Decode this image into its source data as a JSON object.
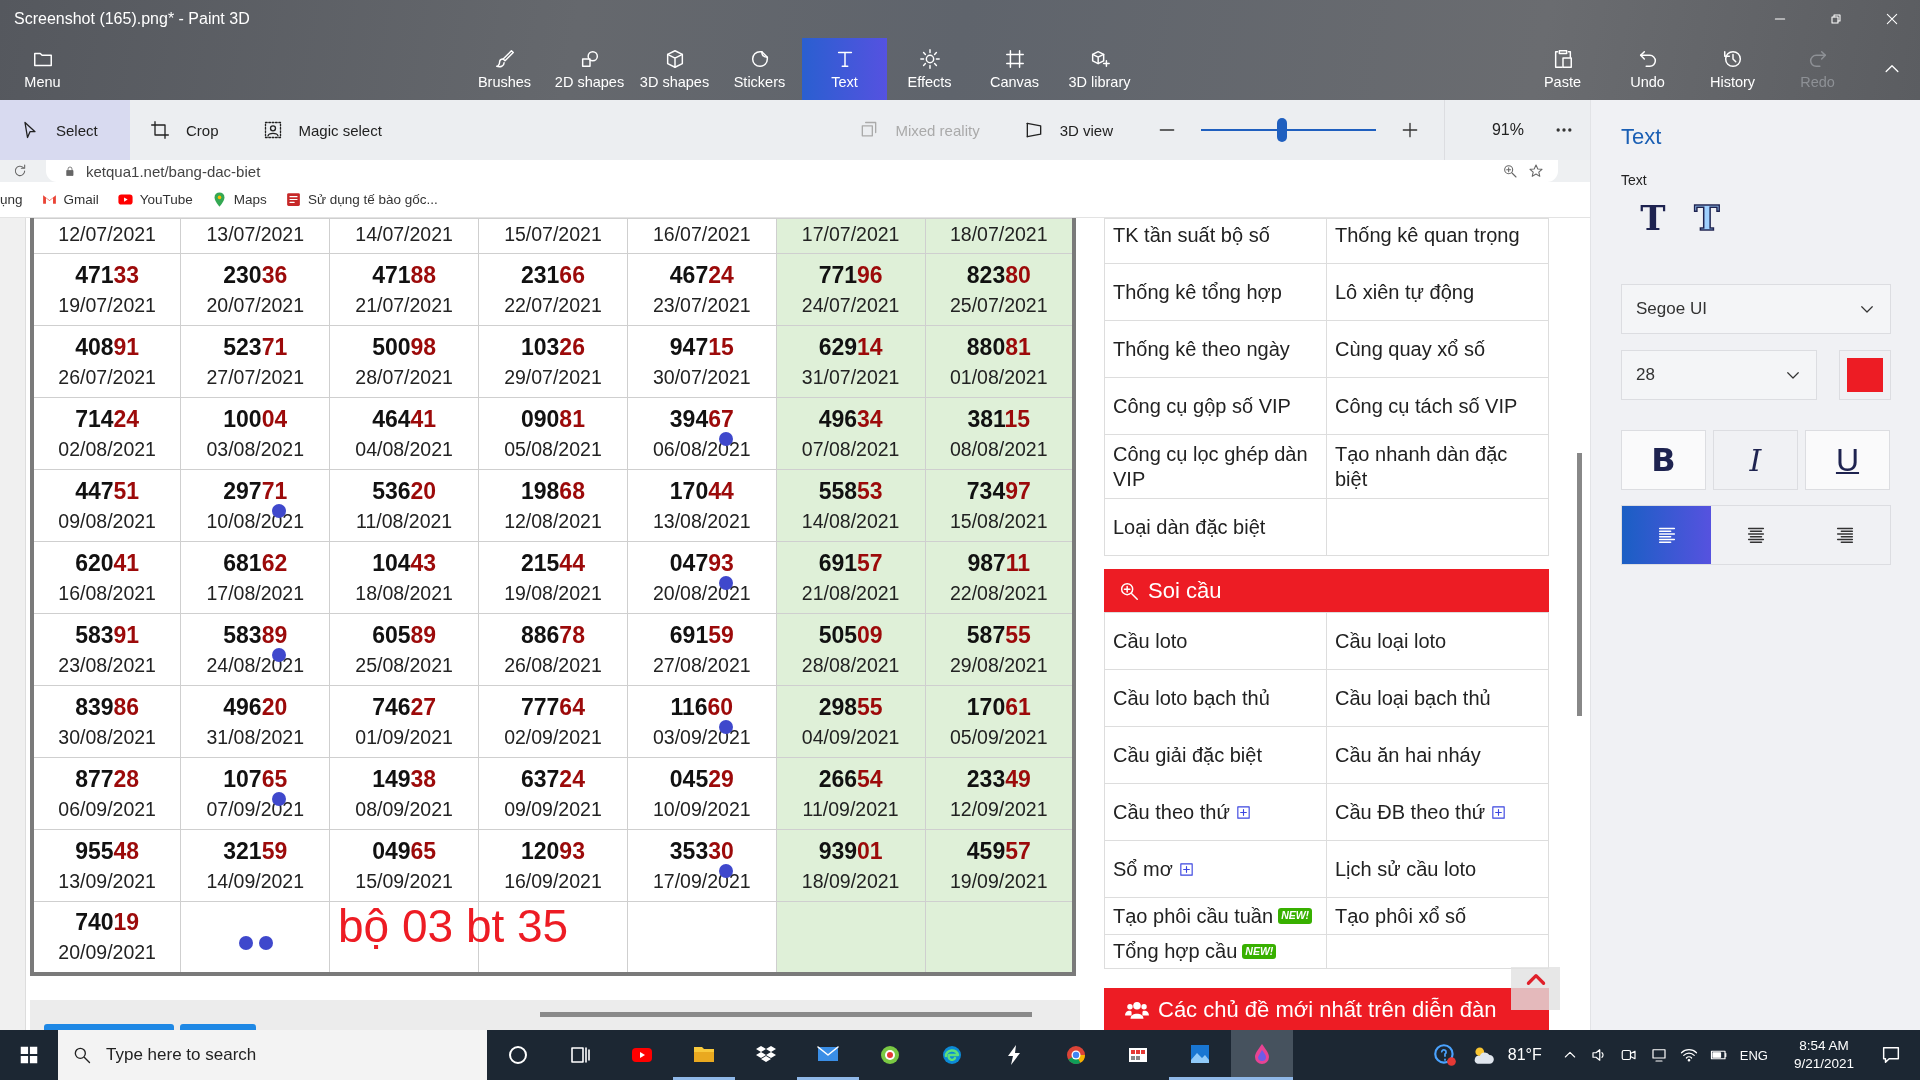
{
  "window": {
    "title": "Screenshot (165).png* - Paint 3D"
  },
  "menu_button": {
    "label": "Menu"
  },
  "tools": [
    {
      "label": "Brushes",
      "kind": "brush",
      "selected": false
    },
    {
      "label": "2D shapes",
      "kind": "shapes",
      "selected": false
    },
    {
      "label": "3D shapes",
      "kind": "cube",
      "selected": false
    },
    {
      "label": "Stickers",
      "kind": "sticker",
      "selected": false
    },
    {
      "label": "Text",
      "kind": "text",
      "selected": true
    },
    {
      "label": "Effects",
      "kind": "effects",
      "selected": false
    },
    {
      "label": "Canvas",
      "kind": "canvas",
      "selected": false
    },
    {
      "label": "3D library",
      "kind": "library",
      "selected": false
    }
  ],
  "actions": [
    {
      "label": "Paste",
      "kind": "paste",
      "disabled": false
    },
    {
      "label": "Undo",
      "kind": "undo",
      "disabled": false
    },
    {
      "label": "History",
      "kind": "history",
      "disabled": false
    },
    {
      "label": "Redo",
      "kind": "redo",
      "disabled": true
    }
  ],
  "subtools": [
    {
      "label": "Select",
      "kind": "select",
      "selected": true
    },
    {
      "label": "Crop",
      "kind": "crop",
      "selected": false
    },
    {
      "label": "Magic select",
      "kind": "magic",
      "selected": false
    }
  ],
  "view_controls": [
    {
      "label": "Mixed reality",
      "kind": "mixed",
      "disabled": true
    },
    {
      "label": "3D view",
      "kind": "view3d",
      "disabled": false
    }
  ],
  "zoom": {
    "level": 0.46,
    "reading": "91%"
  },
  "browser": {
    "url": "ketqua1.net/bang-dac-biet",
    "bookmarks": [
      {
        "label": "ụng",
        "kind": "none"
      },
      {
        "label": "Gmail",
        "kind": "gmail"
      },
      {
        "label": "YouTube",
        "kind": "youtube"
      },
      {
        "label": "Maps",
        "kind": "maps"
      },
      {
        "label": "Sử dụng tế bào gốc...",
        "kind": "doc"
      }
    ]
  },
  "table": {
    "columns": [
      {
        "highlighted": false
      },
      {
        "highlighted": false
      },
      {
        "highlighted": false
      },
      {
        "highlighted": false
      },
      {
        "highlighted": false
      },
      {
        "highlighted": true
      },
      {
        "highlighted": true
      }
    ],
    "header_dates": [
      "12/07/2021",
      "13/07/2021",
      "14/07/2021",
      "15/07/2021",
      "16/07/2021",
      "17/07/2021",
      "18/07/2021"
    ],
    "rows": [
      {
        "cells": [
          {
            "number": "47133",
            "date": "19/07/2021"
          },
          {
            "number": "23036",
            "date": "20/07/2021"
          },
          {
            "number": "47188",
            "date": "21/07/2021"
          },
          {
            "number": "23166",
            "date": "22/07/2021"
          },
          {
            "number": "46724",
            "date": "23/07/2021"
          },
          {
            "number": "77196",
            "date": "24/07/2021"
          },
          {
            "number": "82380",
            "date": "25/07/2021"
          }
        ]
      },
      {
        "cells": [
          {
            "number": "40891",
            "date": "26/07/2021"
          },
          {
            "number": "52371",
            "date": "27/07/2021"
          },
          {
            "number": "50098",
            "date": "28/07/2021"
          },
          {
            "number": "10326",
            "date": "29/07/2021"
          },
          {
            "number": "94715",
            "date": "30/07/2021"
          },
          {
            "number": "62914",
            "date": "31/07/2021"
          },
          {
            "number": "88081",
            "date": "01/08/2021"
          }
        ]
      },
      {
        "cells": [
          {
            "number": "71424",
            "date": "02/08/2021"
          },
          {
            "number": "10004",
            "date": "03/08/2021"
          },
          {
            "number": "46441",
            "date": "04/08/2021"
          },
          {
            "number": "09081",
            "date": "05/08/2021"
          },
          {
            "number": "39467",
            "date": "06/08/2021",
            "marked": true
          },
          {
            "number": "49634",
            "date": "07/08/2021"
          },
          {
            "number": "38115",
            "date": "08/08/2021"
          }
        ]
      },
      {
        "cells": [
          {
            "number": "44751",
            "date": "09/08/2021"
          },
          {
            "number": "29771",
            "date": "10/08/2021",
            "marked": true
          },
          {
            "number": "53620",
            "date": "11/08/2021"
          },
          {
            "number": "19868",
            "date": "12/08/2021"
          },
          {
            "number": "17044",
            "date": "13/08/2021"
          },
          {
            "number": "55853",
            "date": "14/08/2021"
          },
          {
            "number": "73497",
            "date": "15/08/2021"
          }
        ]
      },
      {
        "cells": [
          {
            "number": "62041",
            "date": "16/08/2021"
          },
          {
            "number": "68162",
            "date": "17/08/2021"
          },
          {
            "number": "10443",
            "date": "18/08/2021"
          },
          {
            "number": "21544",
            "date": "19/08/2021"
          },
          {
            "number": "04793",
            "date": "20/08/2021",
            "marked": true
          },
          {
            "number": "69157",
            "date": "21/08/2021"
          },
          {
            "number": "98711",
            "date": "22/08/2021"
          }
        ]
      },
      {
        "cells": [
          {
            "number": "58391",
            "date": "23/08/2021"
          },
          {
            "number": "58389",
            "date": "24/08/2021",
            "marked": true
          },
          {
            "number": "60589",
            "date": "25/08/2021"
          },
          {
            "number": "88678",
            "date": "26/08/2021"
          },
          {
            "number": "69159",
            "date": "27/08/2021"
          },
          {
            "number": "50509",
            "date": "28/08/2021"
          },
          {
            "number": "58755",
            "date": "29/08/2021"
          }
        ]
      },
      {
        "cells": [
          {
            "number": "83986",
            "date": "30/08/2021"
          },
          {
            "number": "49620",
            "date": "31/08/2021"
          },
          {
            "number": "74627",
            "date": "01/09/2021"
          },
          {
            "number": "77764",
            "date": "02/09/2021"
          },
          {
            "number": "11660",
            "date": "03/09/2021",
            "marked": true
          },
          {
            "number": "29855",
            "date": "04/09/2021"
          },
          {
            "number": "17061",
            "date": "05/09/2021"
          }
        ]
      },
      {
        "cells": [
          {
            "number": "87728",
            "date": "06/09/2021"
          },
          {
            "number": "10765",
            "date": "07/09/2021",
            "marked": true
          },
          {
            "number": "14938",
            "date": "08/09/2021"
          },
          {
            "number": "63724",
            "date": "09/09/2021"
          },
          {
            "number": "04529",
            "date": "10/09/2021"
          },
          {
            "number": "26654",
            "date": "11/09/2021"
          },
          {
            "number": "23349",
            "date": "12/09/2021"
          }
        ]
      },
      {
        "cells": [
          {
            "number": "95548",
            "date": "13/09/2021"
          },
          {
            "number": "32159",
            "date": "14/09/2021"
          },
          {
            "number": "04965",
            "date": "15/09/2021"
          },
          {
            "number": "12093",
            "date": "16/09/2021"
          },
          {
            "number": "35330",
            "date": "17/09/2021",
            "marked": true
          },
          {
            "number": "93901",
            "date": "18/09/2021"
          },
          {
            "number": "45957",
            "date": "19/09/2021"
          }
        ]
      },
      {
        "cells": [
          {
            "number": "74019",
            "date": "20/09/2021"
          },
          {
            "marked": true,
            "double": true
          }
        ]
      }
    ]
  },
  "canvas_text": {
    "text": "bộ 03 bt 35",
    "color": "#ed1c24"
  },
  "link_table": {
    "rows": [
      [
        {
          "text": "TK tần suất bộ số"
        },
        {
          "text": "Thống kê quan trọng"
        }
      ],
      [
        {
          "text": "Thống kê tổng hợp"
        },
        {
          "text": "Lô xiên tự động"
        }
      ],
      [
        {
          "text": "Thống kê theo ngày"
        },
        {
          "text": "Cùng quay xổ số"
        }
      ],
      [
        {
          "text": "Công cụ gộp số VIP"
        },
        {
          "text": "Công cụ tách số VIP"
        }
      ],
      [
        {
          "text": "Công cụ lọc ghép dàn VIP"
        },
        {
          "text": "Tạo nhanh dàn đặc biệt"
        }
      ],
      [
        {
          "text": "Loại dàn đặc biệt"
        }
      ]
    ]
  },
  "soi_cau": {
    "title": "Soi cầu",
    "rows": [
      [
        {
          "text": "Cầu loto"
        },
        {
          "text": "Cầu loại loto"
        }
      ],
      [
        {
          "text": "Cầu loto bạch thủ"
        },
        {
          "text": "Cầu loại bạch thủ"
        }
      ],
      [
        {
          "text": "Cầu giải đặc biệt"
        },
        {
          "text": "Cầu ăn hai nháy"
        }
      ],
      [
        {
          "text": "Cầu theo thứ",
          "expandable": true
        },
        {
          "text": "Cầu ĐB theo thứ",
          "expandable": true
        }
      ],
      [
        {
          "text": "Sổ mơ",
          "expandable": true
        },
        {
          "text": "Lịch sử cầu loto"
        }
      ],
      [
        {
          "text": "Tạo phôi cầu tuần",
          "badge": "NEW!"
        },
        {
          "text": "Tạo phôi xổ số"
        }
      ],
      [
        {
          "text": "Tổng hợp cầu",
          "badge": "NEW!"
        }
      ]
    ]
  },
  "forum": {
    "title": "Các chủ đề mới nhất trên diễn đàn"
  },
  "side_panel": {
    "title": "Text",
    "section_label": "Text",
    "text_types": [
      {
        "glyph": "T",
        "kind": "flat"
      },
      {
        "glyph": "T",
        "kind": "solid"
      }
    ],
    "font": "Segoe UI",
    "size": "28",
    "color": "#ed1c24",
    "styles": [
      {
        "label": "B",
        "kind": "bold"
      },
      {
        "label": "I",
        "kind": "italic"
      },
      {
        "label": "U",
        "kind": "underline"
      }
    ],
    "alignments": [
      {
        "kind": "left",
        "selected": true
      },
      {
        "kind": "center",
        "selected": false
      },
      {
        "kind": "right",
        "selected": false
      }
    ]
  },
  "taskbar": {
    "search": {
      "placeholder": "Type here to search"
    },
    "apps": [
      {
        "kind": "cortana",
        "running": false,
        "active": false
      },
      {
        "kind": "taskview",
        "running": false,
        "active": false
      },
      {
        "kind": "youtube",
        "running": false,
        "active": false
      },
      {
        "kind": "explorer",
        "running": true,
        "active": false
      },
      {
        "kind": "dropbox",
        "running": false,
        "active": false
      },
      {
        "kind": "mail",
        "running": true,
        "active": false
      },
      {
        "kind": "target",
        "running": false,
        "active": false
      },
      {
        "kind": "edge",
        "running": false,
        "active": false
      },
      {
        "kind": "bolt",
        "running": false,
        "active": false
      },
      {
        "kind": "chrome",
        "running": false,
        "active": false
      },
      {
        "kind": "grid",
        "running": false,
        "active": false
      },
      {
        "kind": "photos",
        "running": true,
        "active": false
      },
      {
        "kind": "paint3d",
        "running": true,
        "active": true
      }
    ],
    "temperature": "81°F",
    "language": "ENG",
    "time": "8:54 AM",
    "date": "9/21/2021"
  }
}
